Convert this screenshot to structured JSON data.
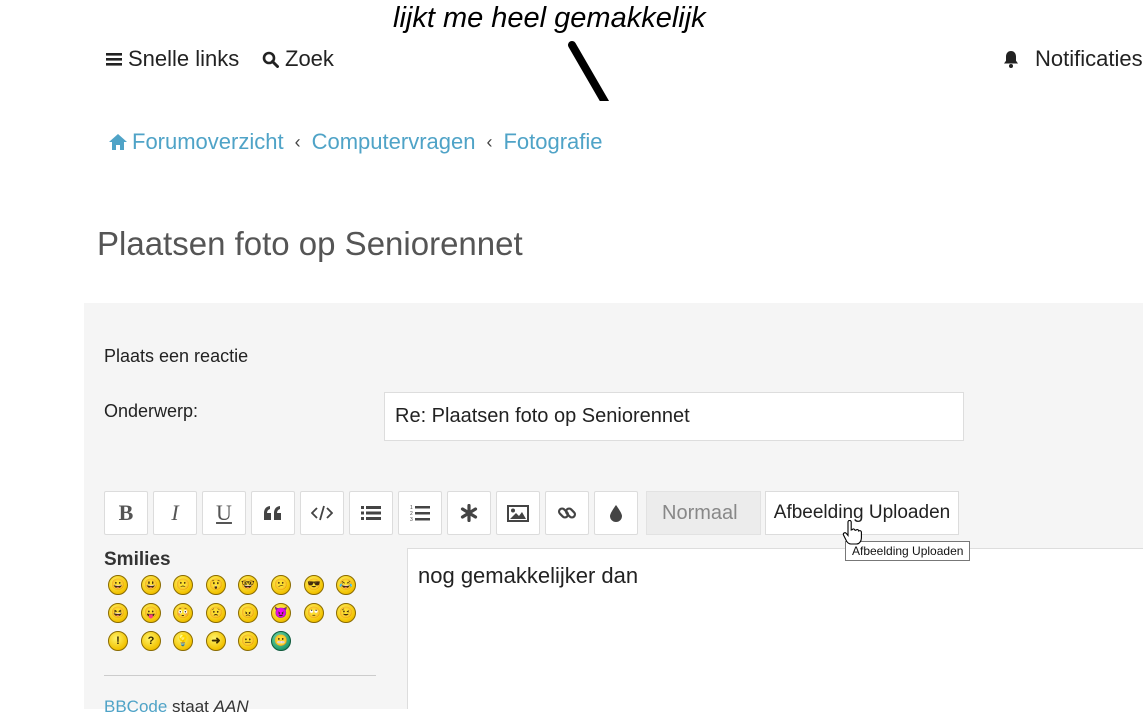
{
  "annotation": {
    "text": "lijkt me heel gemakkelijk"
  },
  "topnav": {
    "quicklinks": "Snelle links",
    "search": "Zoek",
    "notifications": "Notificaties"
  },
  "breadcrumb": {
    "items": [
      "Forumoverzicht",
      "Computervragen",
      "Fotografie"
    ],
    "separator": "‹"
  },
  "topic": {
    "title": "Plaatsen foto op Seniorennet"
  },
  "reply_form": {
    "heading": "Plaats een reactie",
    "subject_label": "Onderwerp:",
    "subject_value": "Re: Plaatsen foto op Seniorennet"
  },
  "toolbar": {
    "buttons": [
      {
        "icon": "bold-icon",
        "label": "B"
      },
      {
        "icon": "italic-icon",
        "label": "I"
      },
      {
        "icon": "underline-icon",
        "label": "U"
      },
      {
        "icon": "quote-icon"
      },
      {
        "icon": "code-icon"
      },
      {
        "icon": "list-icon"
      },
      {
        "icon": "ordered-list-icon"
      },
      {
        "icon": "asterisk-icon"
      },
      {
        "icon": "image-icon"
      },
      {
        "icon": "link-icon"
      },
      {
        "icon": "color-drop-icon"
      }
    ],
    "font_size": "Normaal",
    "upload_label": "Afbeelding Uploaden",
    "upload_tooltip": "Afbeelding Uploaden"
  },
  "smilies": {
    "title": "Smilies",
    "faces": [
      "😀",
      "😃",
      "🙁",
      "😲",
      "🤓",
      "😕",
      "😎",
      "😂",
      "😆",
      "😛",
      "😳",
      "😟",
      "😠",
      "😈",
      "🙄",
      "😉",
      "!",
      "?",
      "💡",
      "➜",
      "😐",
      "😬"
    ]
  },
  "bbcode": {
    "prefix": "BBCode",
    "middle": " staat ",
    "state": "AAN"
  },
  "editor": {
    "content": "nog gemakkelijker dan"
  },
  "colors": {
    "link": "#4fa3c7",
    "panel": "#f5f5f5",
    "smiley": "#f2c200"
  }
}
